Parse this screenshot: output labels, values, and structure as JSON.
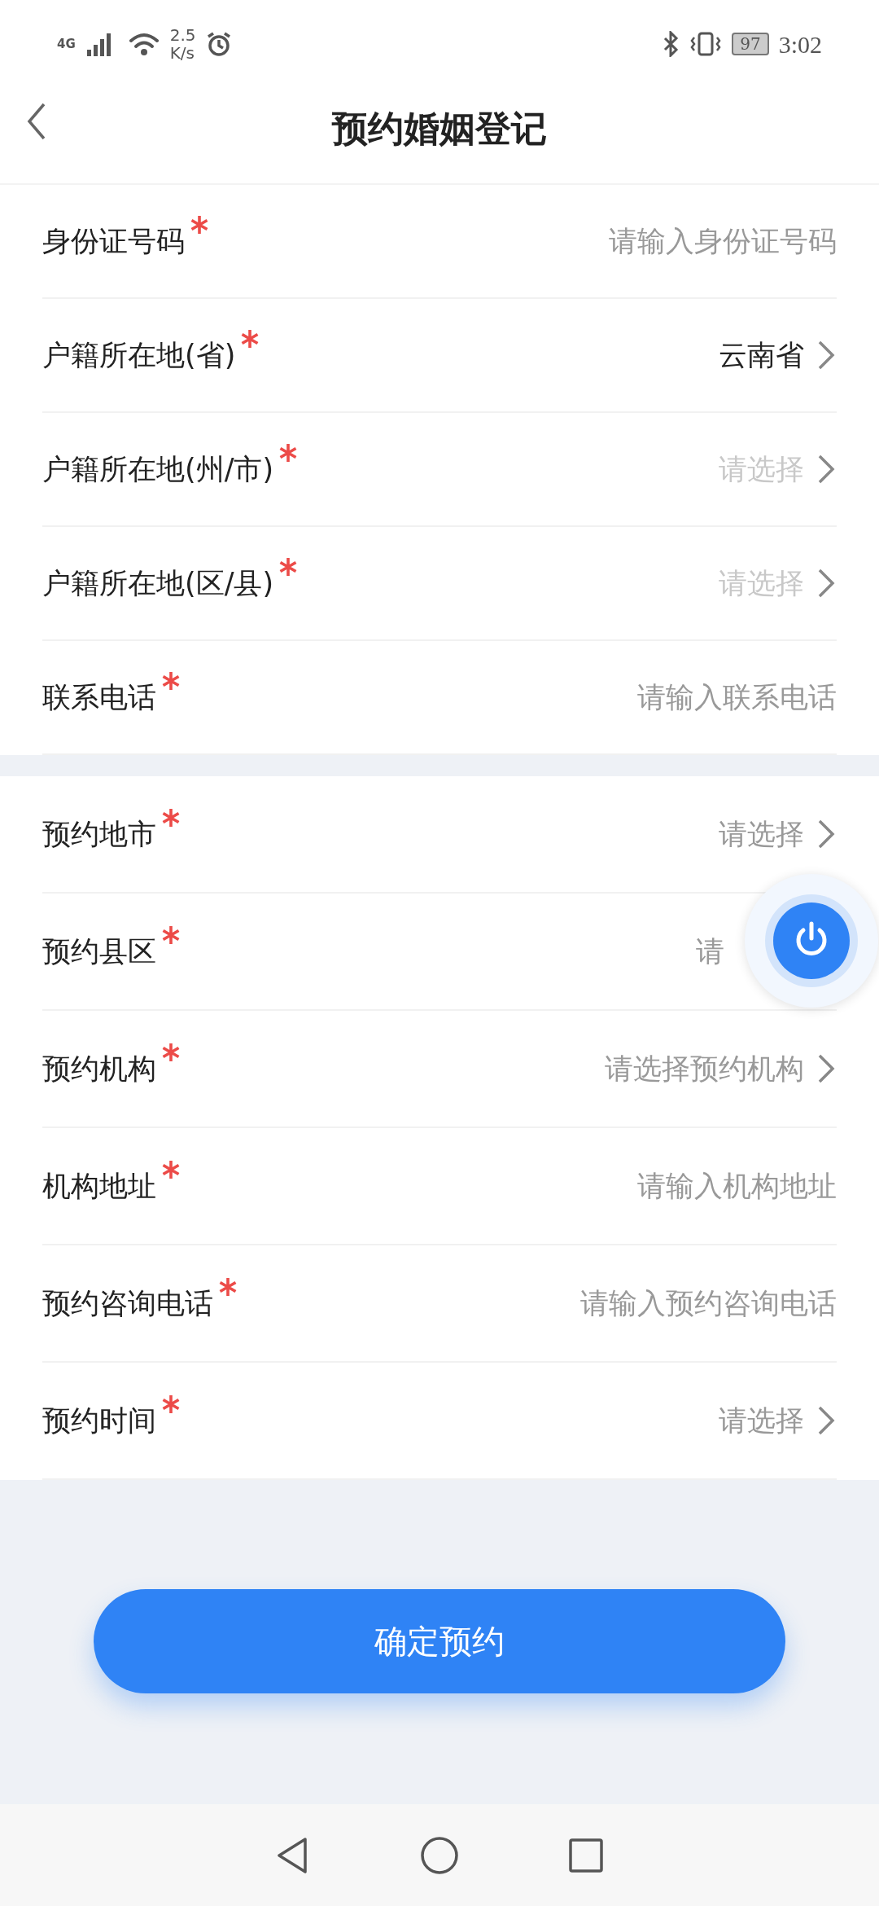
{
  "status_bar": {
    "network": "4G",
    "speed": "2.5",
    "speed_unit": "K/s",
    "battery": "97",
    "time": "3:02"
  },
  "title": "预约婚姻登记",
  "sections": [
    {
      "rows": [
        {
          "label": "身份证号码",
          "required": true,
          "kind": "input",
          "placeholder": "请输入身份证号码"
        },
        {
          "label": "户籍所在地(省)",
          "required": true,
          "kind": "select",
          "value": "云南省",
          "disabled": false
        },
        {
          "label": "户籍所在地(州/市)",
          "required": true,
          "kind": "select",
          "placeholder": "请选择",
          "disabled": true
        },
        {
          "label": "户籍所在地(区/县)",
          "required": true,
          "kind": "select",
          "placeholder": "请选择",
          "disabled": true
        },
        {
          "label": "联系电话",
          "required": true,
          "kind": "input",
          "placeholder": "请输入联系电话"
        }
      ]
    },
    {
      "rows": [
        {
          "label": "预约地市",
          "required": true,
          "kind": "select",
          "placeholder": "请选择",
          "disabled": false
        },
        {
          "label": "预约县区",
          "required": true,
          "kind": "select",
          "placeholder": "请",
          "disabled": false,
          "covered": true
        },
        {
          "label": "预约机构",
          "required": true,
          "kind": "select",
          "placeholder": "请选择预约机构",
          "disabled": false
        },
        {
          "label": "机构地址",
          "required": true,
          "kind": "input",
          "placeholder": "请输入机构地址"
        },
        {
          "label": "预约咨询电话",
          "required": true,
          "kind": "input",
          "placeholder": "请输入预约咨询电话"
        },
        {
          "label": "预约时间",
          "required": true,
          "kind": "select",
          "placeholder": "请选择",
          "disabled": false
        }
      ]
    }
  ],
  "submit_button": "确定预约"
}
